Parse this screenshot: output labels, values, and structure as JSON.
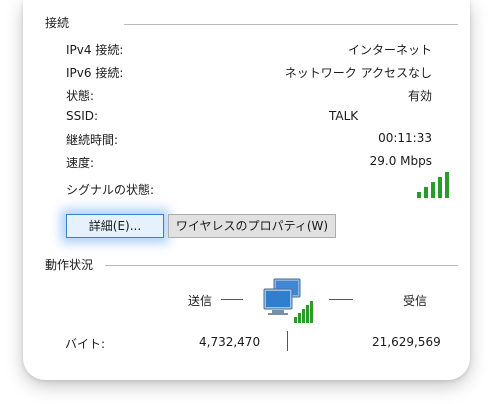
{
  "connection": {
    "group_title": "接続",
    "rows": [
      {
        "label": "IPv4 接続:",
        "value": "インターネット"
      },
      {
        "label": "IPv6 接続:",
        "value": "ネットワーク アクセスなし"
      },
      {
        "label": "状態:",
        "value": "有効"
      },
      {
        "label": "SSID:",
        "value": "TALK"
      },
      {
        "label": "継続時間:",
        "value": "00:11:33"
      },
      {
        "label": "速度:",
        "value": "29.0 Mbps"
      }
    ],
    "signal_label": "シグナルの状態:",
    "signal_bars": 5,
    "signal_color": "#2a9a2a"
  },
  "buttons": {
    "details": "詳細(E)...",
    "wireless_properties": "ワイヤレスのプロパティ(W)"
  },
  "activity": {
    "group_title": "動作状況",
    "sent_label": "送信",
    "received_label": "受信",
    "bytes_label": "バイト:",
    "bytes_sent": "4,732,470",
    "bytes_received": "21,629,569"
  },
  "accent_color": "#3c7fd1"
}
